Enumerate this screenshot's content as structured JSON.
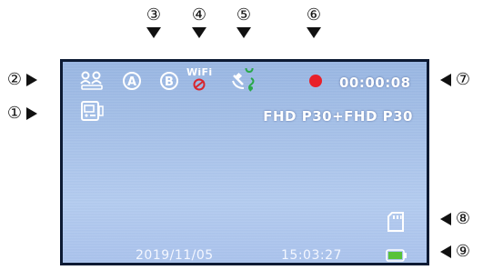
{
  "callouts": {
    "left": [
      {
        "num": "②",
        "target": "mic"
      },
      {
        "num": "①",
        "target": "mode"
      }
    ],
    "top": [
      "③",
      "④",
      "⑤",
      "⑥"
    ],
    "right": [
      "⑦",
      "⑧",
      "⑨"
    ]
  },
  "osd": {
    "wifi_label": "WiFi",
    "rec_time": "00:00:08",
    "resolution": "FHD P30+FHD P30",
    "date": "2019/11/05",
    "time": "15:03:27",
    "cam_a_label": "A",
    "cam_b_label": "B",
    "icons": [
      "voice-record-icon",
      "camera-a-icon",
      "camera-b-icon",
      "wifi-icon",
      "gps-icon",
      "recording-dot-icon",
      "video-mode-icon",
      "sd-card-icon",
      "battery-icon"
    ]
  },
  "colors": {
    "screen_bg": "#a5c0e8",
    "rec_dot": "#e8202a",
    "wifi_red": "#d8262e",
    "gps_green": "#2aa84a",
    "battery_green": "#58c23a",
    "osd_white": "#ffffff"
  }
}
